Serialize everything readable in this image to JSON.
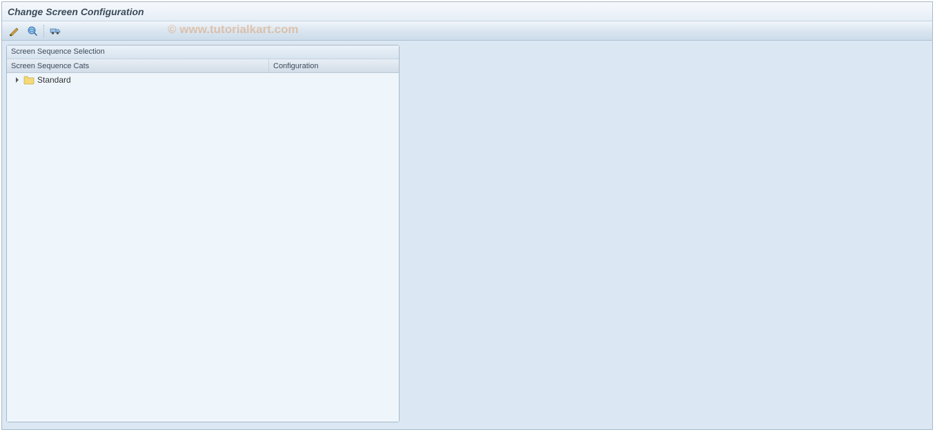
{
  "header": {
    "title": "Change Screen Configuration"
  },
  "toolbar": {
    "buttons": [
      {
        "name": "display-change-toggle",
        "icon": "pencil-glasses-icon"
      },
      {
        "name": "where-used-button",
        "icon": "magnifier-world-icon"
      },
      {
        "name": "transport-button",
        "icon": "transport-truck-icon"
      }
    ]
  },
  "watermark": "© www.tutorialkart.com",
  "panel": {
    "title": "Screen Sequence Selection",
    "columns": {
      "cats": "Screen Sequence Cats",
      "conf": "Configuration"
    },
    "tree": [
      {
        "label": "Standard",
        "expanded": false,
        "configuration": ""
      }
    ]
  }
}
